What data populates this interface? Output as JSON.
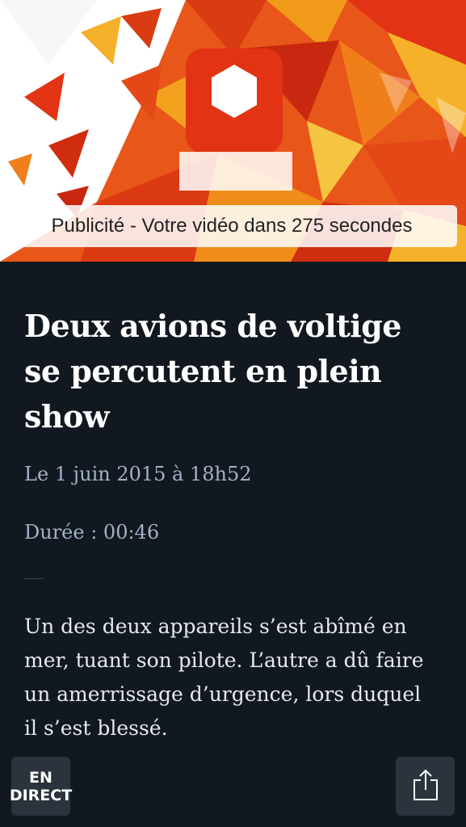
{
  "video": {
    "ad_text": "Publicité - Votre vidéo dans 275 secondes"
  },
  "article": {
    "title": "Deux avions de voltige se percutent en plein show",
    "date": "Le 1 juin 2015 à 18h52",
    "duration": "Durée : 00:46",
    "description": "Un des deux appareils s’est abîmé en mer, tuant son pilote. L’autre a dû faire un amerrissage d’urgence, lors duquel il s’est blessé."
  },
  "bottom_bar": {
    "live_line1": "EN",
    "live_line2": "DIRECT",
    "share_icon": "share-icon"
  },
  "colors": {
    "background": "#111820",
    "text_primary": "#ffffff",
    "text_meta": "#a3b2c6",
    "button_bg": "#2b333d"
  }
}
